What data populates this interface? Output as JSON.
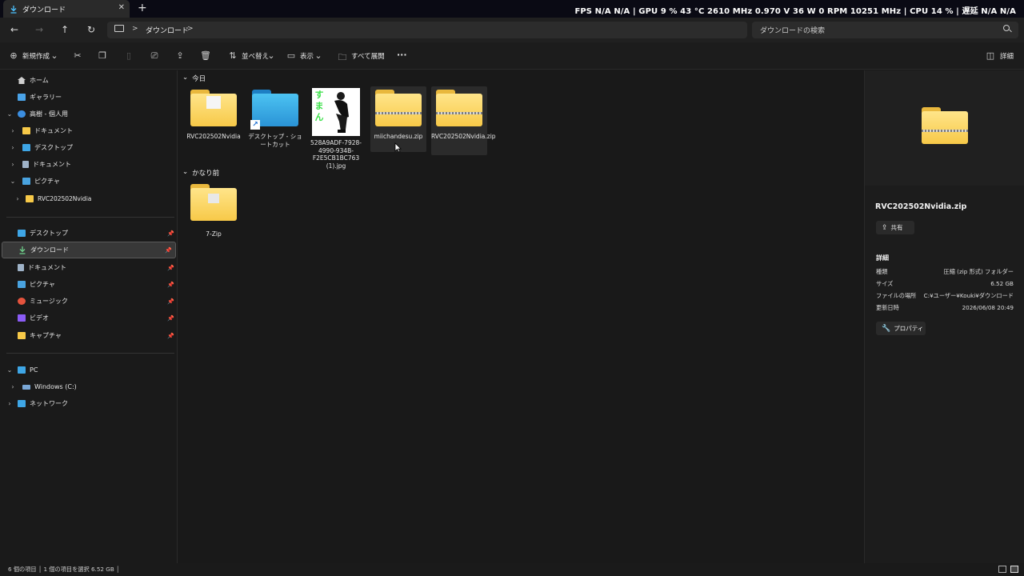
{
  "window": {
    "tab_title": "ダウンロード",
    "tab_close": "✕",
    "new_tab": "+"
  },
  "osd": {
    "text": "FPS N/A N/A | GPU 9 % 43 °C 2610 MHz 0.970 V 36 W 0 RPM 10251 MHz | CPU 14 % | 遅延 N/A N/A"
  },
  "address": {
    "crumb": "ダウンロード",
    "chevron": ">",
    "search_placeholder": "ダウンロードの検索"
  },
  "nav": {
    "back": "←",
    "forward": "→",
    "up": "↑",
    "refresh": "↻"
  },
  "toolbar": {
    "new": "新規作成",
    "sort": "並べ替え",
    "view": "表示",
    "extract_all": "すべて展開",
    "more": "···",
    "details": "詳細",
    "caret": "⌄"
  },
  "sidebar": {
    "home": "ホーム",
    "gallery": "ギャラリー",
    "onedrive": "高樹 - 個人用",
    "od_documents": "ドキュメント",
    "od_desktop": "デスクトップ",
    "od_docs2": "ドキュメント",
    "od_pictures": "ピクチャ",
    "od_rvc": "RVC202502Nvidia",
    "q_desktop": "デスクトップ",
    "q_downloads": "ダウンロード",
    "q_documents": "ドキュメント",
    "q_pictures": "ピクチャ",
    "q_music": "ミュージック",
    "q_videos": "ビデオ",
    "q_captures": "キャプチャ",
    "pc": "PC",
    "drive_c": "Windows (C:)",
    "network": "ネットワーク"
  },
  "content": {
    "group_today": "今日",
    "group_old": "かなり前",
    "items_today": [
      "RVC202502Nvidia",
      "デスクトップ - ショートカット",
      "528A9ADF-7928-4990-934B-F2E5CB1BC763 (1).jpg",
      "miichandesu.zip",
      "RVC202502Nvidia.zip"
    ],
    "items_old": [
      "7-Zip"
    ],
    "photo_text": "すまん"
  },
  "details_pane": {
    "title": "RVC202502Nvidia.zip",
    "share": "共有",
    "section": "詳細",
    "rows": [
      {
        "k": "種類",
        "v": "圧縮 (zip 形式) フォルダー"
      },
      {
        "k": "サイズ",
        "v": "6.52 GB"
      },
      {
        "k": "ファイルの場所",
        "v": "C:¥ユーザー¥Kouki¥ダウンロード"
      },
      {
        "k": "更新日時",
        "v": "2026/06/08 20:49"
      }
    ],
    "properties": "プロパティ"
  },
  "status": {
    "text": "6 個の項目 │ 1 個の項目を選択 6.52 GB │"
  },
  "colors": {
    "accent": "#0078d4",
    "folder": "#f7c948",
    "background": "#191919"
  }
}
